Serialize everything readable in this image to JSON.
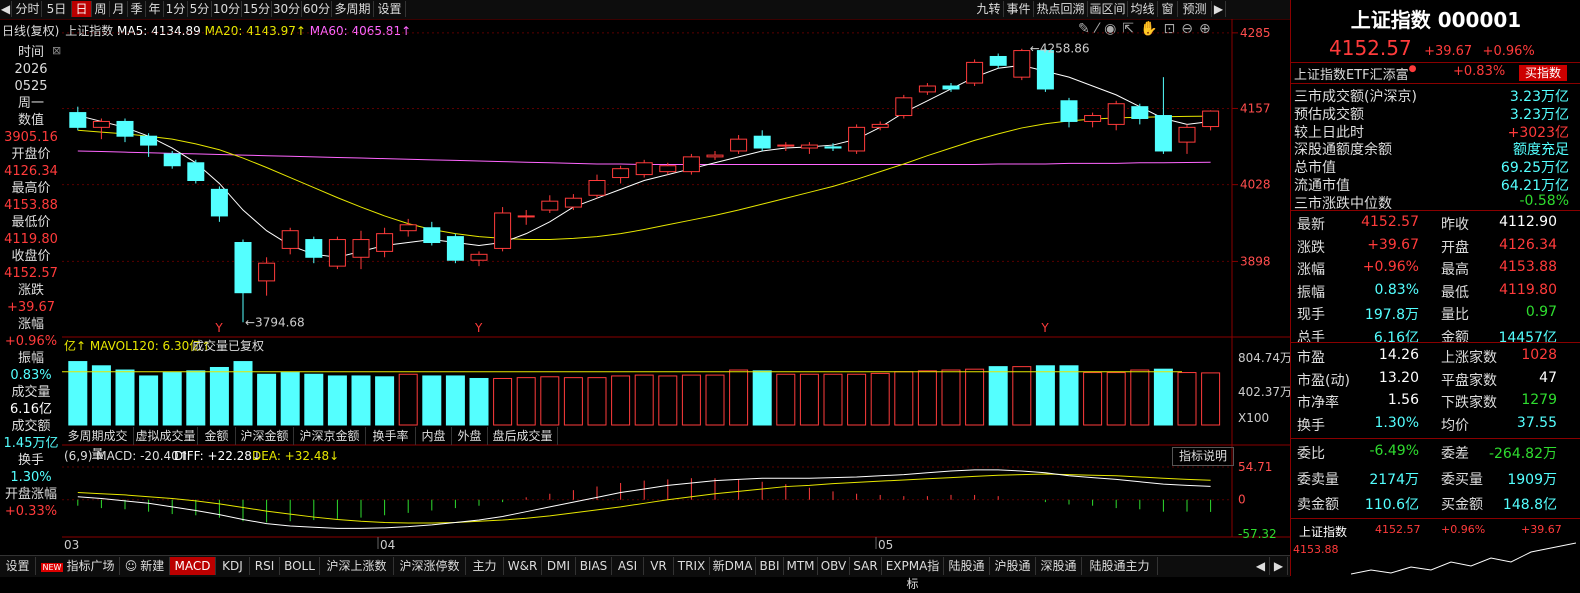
{
  "toolbar": {
    "left": [
      "分时",
      "5日",
      "日",
      "周",
      "月",
      "季",
      "年",
      "1分",
      "5分",
      "10分",
      "15分",
      "30分",
      "60分",
      "多周期",
      "设置"
    ],
    "selected": "日",
    "right": [
      "九转",
      "事件",
      "热点回溯",
      "画区间",
      "均线",
      "窗",
      "预测"
    ]
  },
  "chart_header": {
    "title": "日线(复权)",
    "name": "上证指数",
    "ma5": "MA5: 4134.89",
    "ma20": "MA20: 4143.97↑",
    "ma60": "MA60: 4065.81↑"
  },
  "left_panel": {
    "items": [
      {
        "label": "时间",
        "value": "2026",
        "value2": "0525",
        "value3": "周一"
      },
      {
        "label": "数值",
        "value": "3905.16"
      },
      {
        "label": "开盘价",
        "value": "4126.34"
      },
      {
        "label": "最高价",
        "value": "4153.88"
      },
      {
        "label": "最低价",
        "value": "4119.80"
      },
      {
        "label": "收盘价",
        "value": "4152.57"
      },
      {
        "label": "涨跌",
        "value": "+39.67"
      },
      {
        "label": "涨幅",
        "value": "+0.96%"
      },
      {
        "label": "振幅",
        "value": "0.83%"
      },
      {
        "label": "成交量",
        "value": "6.16亿"
      },
      {
        "label": "成交额",
        "value": "1.45万亿"
      },
      {
        "label": "换手",
        "value": "1.30%"
      },
      {
        "label": "开盘涨幅",
        "value": "+0.33%"
      }
    ]
  },
  "price_axis": [
    "4285",
    "4157",
    "4028",
    "3898"
  ],
  "annotations": {
    "high": "4258.86",
    "low": "3794.68",
    "markers": [
      "Y",
      "Y",
      "Y"
    ]
  },
  "volume": {
    "header_mavol": "亿↑ MAVOL120: 6.30亿↑",
    "header_note": "成交量已复权",
    "axis": [
      "804.74万",
      "402.37万",
      "X100"
    ],
    "tabs": [
      "多周期成交量",
      "虚拟成交量",
      "金额",
      "沪深金额",
      "沪深京金额",
      "换手率",
      "内盘",
      "外盘",
      "盘后成交量"
    ]
  },
  "macd": {
    "header": "(6,9) MACD: -20.40↑",
    "diff": "DIFF: +22.28↓",
    "dea": "DEA: +32.48↓",
    "explain": "指标说明",
    "axis": [
      "54.71",
      "0",
      "-57.32"
    ]
  },
  "date_axis": [
    "03",
    "04",
    "05"
  ],
  "bottom_tabs": [
    "设置",
    "指标广场",
    "新建",
    "MACD",
    "KDJ",
    "RSI",
    "BOLL",
    "沪深上涨数",
    "沪深涨停数",
    "主力",
    "W&R",
    "DMI",
    "BIAS",
    "ASI",
    "VR",
    "TRIX",
    "新DMA",
    "BBI",
    "MTM",
    "OBV",
    "SAR",
    "EXPMA指标",
    "陆股通",
    "沪股通",
    "深股通",
    "陆股通主力"
  ],
  "bottom_selected": "MACD",
  "new_badge": "NEW",
  "right_panel": {
    "title": "上证指数 000001",
    "price": "4152.57",
    "change": "+39.67",
    "pct": "+0.96%",
    "etf_name": "上证指数ETF汇添富",
    "etf_pct": "+0.83%",
    "buy_btn": "买指数",
    "stats1": [
      {
        "l": "三市成交额(沪深京)",
        "v": "3.23万亿",
        "c": "cyan"
      },
      {
        "l": "预估成交额",
        "v": "3.23万亿",
        "c": "cyan"
      },
      {
        "l": "较上日此时",
        "v": "+3023亿",
        "c": "red"
      },
      {
        "l": "深股通额度余额",
        "v": "额度充足",
        "c": "cyan"
      },
      {
        "l": "总市值",
        "v": "69.25万亿",
        "c": "cyan"
      },
      {
        "l": "流通市值",
        "v": "64.21万亿",
        "c": "cyan"
      },
      {
        "l": "三市涨跌中位数",
        "v": "-0.58%",
        "c": "grn"
      }
    ],
    "quote": [
      [
        "最新",
        "4152.57",
        "red",
        "昨收",
        "4112.90",
        "wht"
      ],
      [
        "涨跌",
        "+39.67",
        "red",
        "开盘",
        "4126.34",
        "red"
      ],
      [
        "涨幅",
        "+0.96%",
        "red",
        "最高",
        "4153.88",
        "red"
      ],
      [
        "振幅",
        "0.83%",
        "cyan",
        "最低",
        "4119.80",
        "red"
      ],
      [
        "现手",
        "197.8万",
        "cyan",
        "量比",
        "0.97",
        "grn"
      ],
      [
        "总手",
        "6.16亿",
        "cyan",
        "金额",
        "14457亿",
        "cyan"
      ]
    ],
    "market": [
      [
        "市盈",
        "14.26",
        "wht",
        "上涨家数",
        "1028",
        "red"
      ],
      [
        "市盈(动)",
        "13.20",
        "wht",
        "平盘家数",
        "47",
        "wht"
      ],
      [
        "市净率",
        "1.56",
        "wht",
        "下跌家数",
        "1279",
        "grn"
      ],
      [
        "换手",
        "1.30%",
        "cyan",
        "均价",
        "37.55",
        "cyan"
      ]
    ],
    "order": [
      [
        "委比",
        "-6.49%",
        "grn",
        "委差",
        "-264.82万",
        "grn"
      ],
      [
        "委卖量",
        "2174万",
        "cyan",
        "委买量",
        "1909万",
        "cyan"
      ],
      [
        "卖金额",
        "110.6亿",
        "cyan",
        "买金额",
        "148.8亿",
        "cyan"
      ]
    ],
    "mini": {
      "name": "上证指数",
      "price": "4152.57",
      "pct": "+0.96%",
      "chg": "+39.67",
      "axis": "4153.88"
    }
  },
  "chart_data": {
    "type": "candlestick",
    "note_range": [
      3794.68,
      4258.86
    ],
    "candles": [
      [
        4150,
        4125,
        4160,
        4120
      ],
      [
        4125,
        4135,
        4140,
        4105
      ],
      [
        4135,
        4110,
        4140,
        4100
      ],
      [
        4110,
        4095,
        4115,
        4075
      ],
      [
        4080,
        4060,
        4085,
        4055
      ],
      [
        4065,
        4035,
        4070,
        4030
      ],
      [
        4020,
        3975,
        4025,
        3965
      ],
      [
        3930,
        3845,
        3935,
        3795
      ],
      [
        3865,
        3895,
        3905,
        3840
      ],
      [
        3920,
        3950,
        3955,
        3910
      ],
      [
        3935,
        3905,
        3940,
        3895
      ],
      [
        3890,
        3935,
        3940,
        3885
      ],
      [
        3905,
        3935,
        3950,
        3885
      ],
      [
        3915,
        3945,
        3955,
        3905
      ],
      [
        3950,
        3960,
        3970,
        3940
      ],
      [
        3955,
        3930,
        3965,
        3925
      ],
      [
        3940,
        3900,
        3945,
        3895
      ],
      [
        3900,
        3910,
        3915,
        3890
      ],
      [
        3920,
        3980,
        3990,
        3915
      ],
      [
        3975,
        3975,
        3985,
        3960
      ],
      [
        3985,
        4000,
        4010,
        3980
      ],
      [
        3990,
        4005,
        4012,
        3985
      ],
      [
        4010,
        4035,
        4045,
        4005
      ],
      [
        4040,
        4055,
        4060,
        4030
      ],
      [
        4045,
        4065,
        4070,
        4040
      ],
      [
        4050,
        4060,
        4065,
        4045
      ],
      [
        4050,
        4075,
        4080,
        4045
      ],
      [
        4075,
        4078,
        4085,
        4070
      ],
      [
        4085,
        4105,
        4112,
        4080
      ],
      [
        4110,
        4090,
        4120,
        4085
      ],
      [
        4095,
        4095,
        4100,
        4085
      ],
      [
        4090,
        4095,
        4100,
        4080
      ],
      [
        4092,
        4090,
        4098,
        4085
      ],
      [
        4085,
        4125,
        4130,
        4080
      ],
      [
        4125,
        4130,
        4135,
        4120
      ],
      [
        4145,
        4175,
        4180,
        4140
      ],
      [
        4185,
        4195,
        4200,
        4180
      ],
      [
        4195,
        4190,
        4200,
        4185
      ],
      [
        4200,
        4235,
        4240,
        4195
      ],
      [
        4245,
        4230,
        4250,
        4225
      ],
      [
        4210,
        4255,
        4258,
        4205
      ],
      [
        4255,
        4190,
        4258.86,
        4185
      ],
      [
        4170,
        4135,
        4175,
        4125
      ],
      [
        4135,
        4145,
        4150,
        4125
      ],
      [
        4130,
        4165,
        4170,
        4120
      ],
      [
        4160,
        4140,
        4165,
        4130
      ],
      [
        4145,
        4085,
        4210,
        4080
      ],
      [
        4100,
        4125,
        4130,
        4080
      ],
      [
        4126.34,
        4152.57,
        4153.88,
        4119.8
      ]
    ],
    "ma5": [
      4145,
      4135,
      4125,
      4110,
      4090,
      4065,
      4030,
      3985,
      3950,
      3925,
      3910,
      3905,
      3915,
      3925,
      3930,
      3935,
      3930,
      3925,
      3930,
      3945,
      3965,
      3990,
      4005,
      4020,
      4035,
      4045,
      4055,
      4065,
      4075,
      4085,
      4090,
      4092,
      4095,
      4105,
      4125,
      4150,
      4170,
      4190,
      4210,
      4225,
      4230,
      4220,
      4210,
      4195,
      4180,
      4160,
      4140,
      4130,
      4134.89
    ],
    "ma20": [
      4120,
      4117,
      4114,
      4110,
      4105,
      4097,
      4087,
      4073,
      4057,
      4040,
      4023,
      4006,
      3990,
      3975,
      3962,
      3952,
      3945,
      3940,
      3937,
      3935,
      3935,
      3937,
      3940,
      3945,
      3952,
      3960,
      3968,
      3976,
      3985,
      3995,
      4005,
      4015,
      4025,
      4037,
      4050,
      4063,
      4077,
      4090,
      4103,
      4114,
      4124,
      4131,
      4136,
      4139,
      4141,
      4142,
      4143,
      4143.5,
      4143.97
    ],
    "ma60": [
      4085,
      4084,
      4083,
      4082,
      4081,
      4080,
      4079,
      4078,
      4077,
      4076,
      4075,
      4074,
      4073,
      4072,
      4071,
      4070,
      4069,
      4068,
      4067,
      4066,
      4065,
      4064,
      4063,
      4063,
      4062,
      4062,
      4062,
      4062,
      4062,
      4062,
      4062,
      4062,
      4062,
      4062,
      4062,
      4062,
      4062,
      4062,
      4062,
      4063,
      4063,
      4063,
      4064,
      4064,
      4064,
      4065,
      4065,
      4065.5,
      4065.81
    ],
    "volume_up": [
      0,
      0,
      0,
      0,
      0,
      0,
      0,
      0,
      0,
      0,
      0,
      0,
      0,
      0,
      1,
      0,
      0,
      0,
      1,
      1,
      1,
      1,
      1,
      1,
      1,
      1,
      1,
      1,
      1,
      0,
      1,
      1,
      1,
      1,
      1,
      1,
      1,
      1,
      1,
      0,
      1,
      0,
      0,
      1,
      1,
      1,
      0,
      1,
      1
    ],
    "volume": [
      7.5,
      7.0,
      6.5,
      5.8,
      6.2,
      6.4,
      6.8,
      7.5,
      6.0,
      6.2,
      6.0,
      5.8,
      5.8,
      5.7,
      6.0,
      5.8,
      5.8,
      5.5,
      5.5,
      5.6,
      5.7,
      5.6,
      5.6,
      5.8,
      5.9,
      5.8,
      5.9,
      5.9,
      6.5,
      6.4,
      6.0,
      6.0,
      6.0,
      6.0,
      6.1,
      6.3,
      6.4,
      6.5,
      6.6,
      6.9,
      6.9,
      7.0,
      7.0,
      6.2,
      6.2,
      6.5,
      6.6,
      6.2,
      6.16
    ],
    "macd_bars": [
      -10,
      -14,
      -16,
      -20,
      -24,
      -26,
      -30,
      -36,
      -38,
      -36,
      -34,
      -32,
      -30,
      -26,
      -22,
      -18,
      -14,
      -10,
      -4,
      4,
      10,
      16,
      22,
      28,
      32,
      34,
      36,
      36,
      34,
      30,
      26,
      20,
      14,
      10,
      8,
      6,
      6,
      8,
      8,
      6,
      0,
      -4,
      -8,
      -10,
      -14,
      -16,
      -20,
      -20,
      -20.4
    ],
    "diff": [
      5,
      2,
      -2,
      -6,
      -12,
      -18,
      -25,
      -33,
      -40,
      -44,
      -46,
      -48,
      -48,
      -47,
      -45,
      -42,
      -38,
      -34,
      -28,
      -20,
      -12,
      -4,
      4,
      12,
      18,
      24,
      28,
      32,
      34,
      36,
      36,
      36,
      37,
      38,
      40,
      42,
      45,
      48,
      50,
      50,
      48,
      45,
      40,
      37,
      34,
      30,
      26,
      24,
      22.28
    ],
    "dea": [
      12,
      10,
      8,
      5,
      2,
      -2,
      -7,
      -13,
      -19,
      -24,
      -29,
      -33,
      -36,
      -38,
      -39,
      -39,
      -38,
      -36,
      -34,
      -31,
      -27,
      -22,
      -17,
      -12,
      -6,
      0,
      5,
      10,
      14,
      18,
      22,
      24,
      27,
      29,
      31,
      33,
      35,
      37,
      39,
      41,
      42,
      43,
      42,
      41,
      40,
      38,
      36,
      34,
      32.48
    ]
  }
}
